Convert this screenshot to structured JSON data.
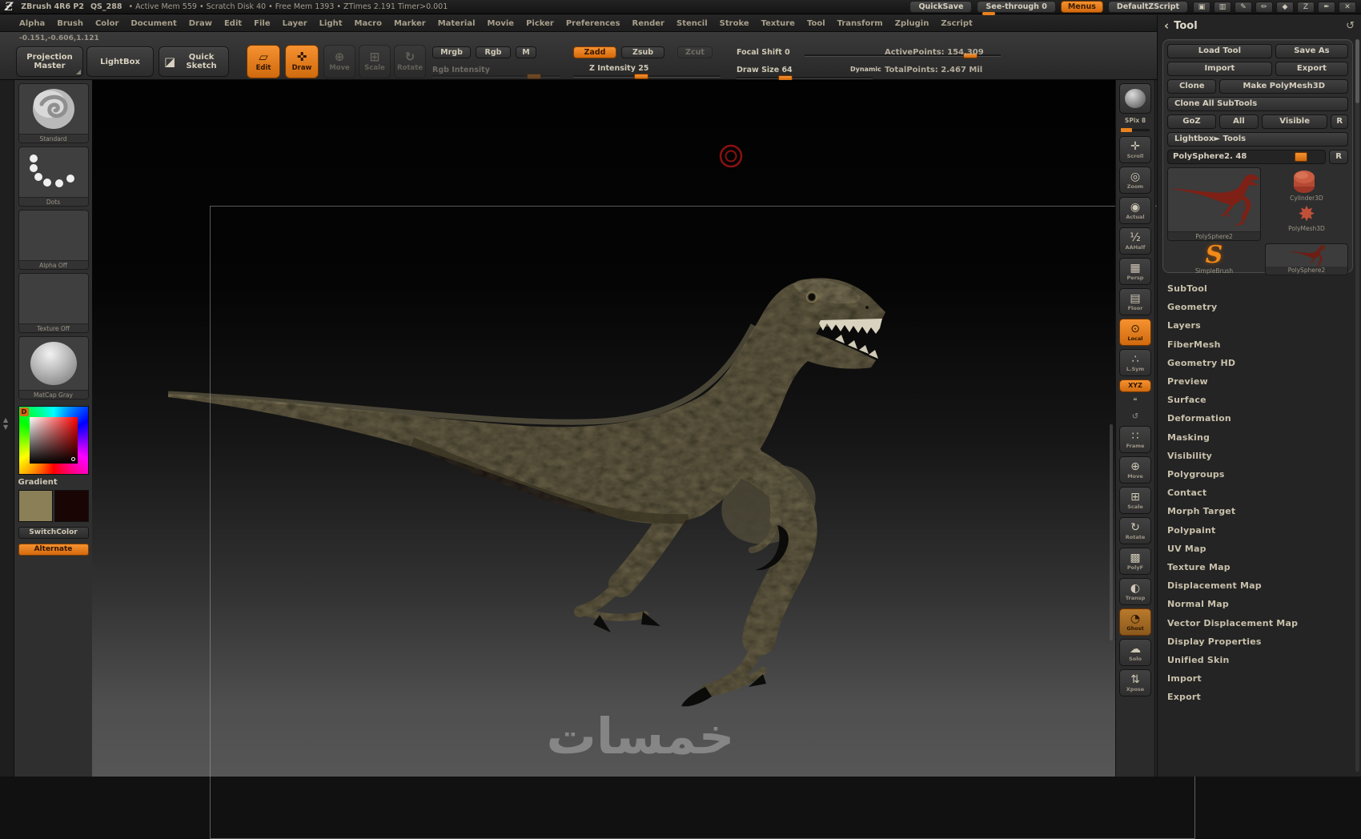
{
  "colors": {
    "accent": "#e8821e",
    "canvas_bottom": "#565656",
    "raptor_body": "#625a42"
  },
  "titlebar": {
    "logo": "Ƶ",
    "app": "ZBrush 4R6 P2",
    "doc": "QS_288",
    "stats": "• Active Mem 559 • Scratch Disk 40 • Free Mem 1393 • ZTimes 2.191  Timer>0.001",
    "quicksave": "QuickSave",
    "see_through": "See-through 0",
    "menus": "Menus",
    "default_zscript": "DefaultZScript",
    "window_icons": [
      {
        "glyph": "▣",
        "name": "divider-icon"
      },
      {
        "glyph": "▥",
        "name": "divider-alt-icon"
      },
      {
        "glyph": "✎",
        "name": "customize-icon"
      },
      {
        "glyph": "✏",
        "name": "customize-alt-icon"
      },
      {
        "glyph": "◆",
        "name": "lock-icon"
      },
      {
        "glyph": "Z",
        "name": "zoom-window-icon"
      },
      {
        "glyph": "✒",
        "name": "pen-icon"
      },
      {
        "glyph": "✕",
        "name": "close-icon"
      }
    ]
  },
  "menubar": {
    "items": [
      "Alpha",
      "Brush",
      "Color",
      "Document",
      "Draw",
      "Edit",
      "File",
      "Layer",
      "Light",
      "Macro",
      "Marker",
      "Material",
      "Movie",
      "Picker",
      "Preferences",
      "Render",
      "Stencil",
      "Stroke",
      "Texture",
      "Tool",
      "Transform",
      "Zplugin",
      "Zscript"
    ]
  },
  "toolbar": {
    "coords": "-0.151,-0.606,1.121",
    "projection_master": "Projection Master",
    "lightbox": "LightBox",
    "quick_sketch": "Quick Sketch",
    "edit": "Edit",
    "draw": "Draw",
    "move": "Move",
    "scale": "Scale",
    "rotate": "Rotate",
    "mrgb": "Mrgb",
    "rgb": "Rgb",
    "m": "M",
    "rgb_intensity": "Rgb Intensity",
    "zadd": "Zadd",
    "zsub": "Zsub",
    "zcut": "Zcut",
    "z_intensity": "Z Intensity 25",
    "focal_shift": "Focal Shift 0",
    "draw_size": "Draw Size 64",
    "dynamic": "Dynamic",
    "active_points": "ActivePoints: 154,309",
    "total_points": "TotalPoints: 2.467 Mil"
  },
  "left_tray": {
    "brush_label": "Standard",
    "stroke_label": "Dots",
    "alpha_label": "Alpha Off",
    "texture_label": "Texture Off",
    "material_label": "MatCap Gray",
    "picker_badge": "D",
    "gradient_label": "Gradient",
    "main_color": "#8a7f56",
    "alt_color": "#1a0505",
    "switch_color": "SwitchColor",
    "alternate": "Alternate"
  },
  "canvas": {
    "watermark": "خمسات"
  },
  "right_shelf": {
    "spix_label": "SPix 8",
    "buttons": [
      {
        "name": "scroll-button",
        "glyph": "✛",
        "label": "Scroll"
      },
      {
        "name": "zoom-button",
        "glyph": "◎",
        "label": "Zoom"
      },
      {
        "name": "actual-button",
        "glyph": "◉",
        "label": "Actual"
      },
      {
        "name": "aahalf-button",
        "glyph": "½",
        "label": "AAHalf"
      },
      {
        "name": "persp-button",
        "glyph": "▦",
        "label": "Persp"
      },
      {
        "name": "floor-button",
        "glyph": "▤",
        "label": "Floor"
      },
      {
        "name": "local-button",
        "glyph": "⊙",
        "label": "Local",
        "cls": "active"
      },
      {
        "name": "lsym-button",
        "glyph": "∴",
        "label": "L.Sym"
      },
      {
        "name": "xyz-button",
        "glyph": "",
        "label": "XYZ",
        "cls": "active chip2"
      },
      {
        "name": "comment-icon-button",
        "glyph": "❝",
        "label": "",
        "cls": "tiny"
      },
      {
        "name": "history-icon-button",
        "glyph": "↺",
        "label": "",
        "cls": "tiny"
      },
      {
        "name": "frame-button",
        "glyph": "∷",
        "label": "Frame"
      },
      {
        "name": "move-view-button",
        "glyph": "⊕",
        "label": "Move"
      },
      {
        "name": "scale-view-button",
        "glyph": "⊞",
        "label": "Scale"
      },
      {
        "name": "rotate-view-button",
        "glyph": "↻",
        "label": "Rotate"
      },
      {
        "name": "polyf-button",
        "glyph": "▩",
        "label": "PolyF"
      },
      {
        "name": "transp-button",
        "glyph": "◐",
        "label": "Transp"
      },
      {
        "name": "ghost-button",
        "glyph": "◔",
        "label": "Ghost",
        "cls": "active ghost"
      },
      {
        "name": "solo-button",
        "glyph": "☁",
        "label": "Solo"
      },
      {
        "name": "xpose-button",
        "glyph": "⇅",
        "label": "Xpose"
      }
    ]
  },
  "tool_panel": {
    "back_icon": "‹",
    "title": "Tool",
    "refresh_icon": "↺",
    "load_tool": "Load Tool",
    "save_as": "Save As",
    "import": "Import",
    "export": "Export",
    "clone": "Clone",
    "make_polymesh3d": "Make PolyMesh3D",
    "clone_all_subtools": "Clone All SubTools",
    "goz": "GoZ",
    "all": "All",
    "visible": "Visible",
    "r": "R",
    "lightbox_tools": "Lightbox► Tools",
    "tool_name_slider": "PolySphere2. 48",
    "active_tool_label": "PolySphere2",
    "thumb_cylinder": "Cylinder3D",
    "thumb_polymesh": "PolyMesh3D",
    "thumb_simplebrush": "SimpleBrush",
    "thumb_polysphere": "PolySphere2",
    "sections": [
      "SubTool",
      "Geometry",
      "Layers",
      "FiberMesh",
      "Geometry HD",
      "Preview",
      "Surface",
      "Deformation",
      "Masking",
      "Visibility",
      "Polygroups",
      "Contact",
      "Morph Target",
      "Polypaint",
      "UV Map",
      "Texture Map",
      "Displacement Map",
      "Normal Map",
      "Vector Displacement Map",
      "Display Properties",
      "Unified Skin",
      "Import",
      "Export"
    ]
  }
}
